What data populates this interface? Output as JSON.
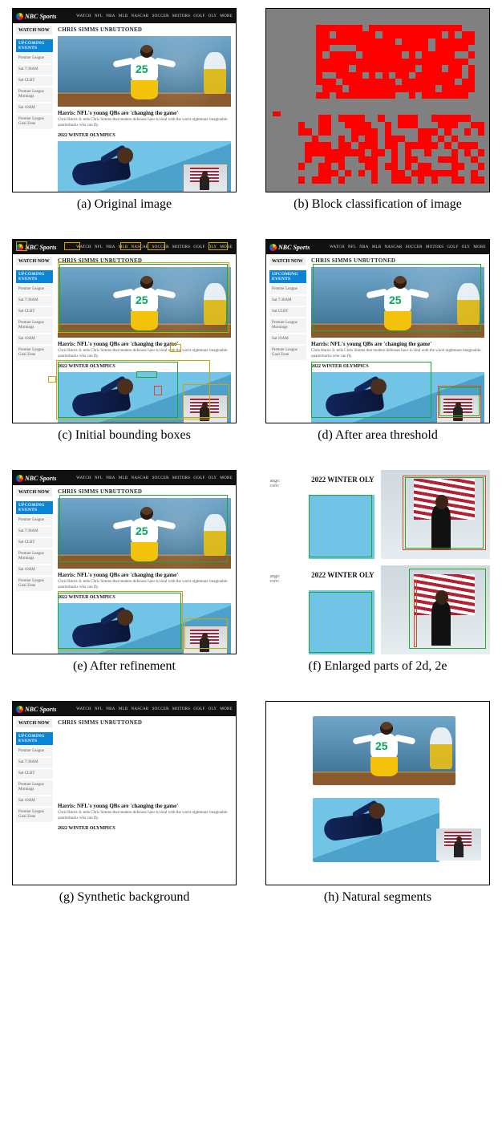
{
  "captions": {
    "a": "(a) Original image",
    "b": "(b) Block classification of image",
    "c": "(c) Initial bounding boxes",
    "d": "(d) After area threshold",
    "e": "(e) After refinement",
    "f": "(f) Enlarged parts of 2d, 2e",
    "g": "(g) Synthetic background",
    "h": "(h) Natural segments"
  },
  "site": {
    "brand": "NBC Sports",
    "nav": [
      "WATCH",
      "NFL",
      "NBA",
      "MLB",
      "NASCAR",
      "SOCCER",
      "MOTORS",
      "GOLF",
      "OLY",
      "MORE"
    ],
    "watch_now": "WATCH NOW",
    "upcoming": "UPCOMING EVENTS",
    "sidebar_items": [
      "Premier League",
      "Sat 7:30AM",
      "Sat CLBT",
      "Premier League Mornings",
      "Sat 10AM",
      "Premier League Goal Zone"
    ],
    "page_title": "CHRIS SIMMS UNBUTTONED",
    "hero_jersey_number": "25",
    "headline": "Harris: NFL's young QBs are 'changing the game'",
    "subhead": "Chris Harris Jr. tells Chris Simms that modern defenses have to deal with the worst nightmare imaginable: quarterbacks who can fly.",
    "section2_title": "2022 WINTER OLYMPICS"
  },
  "panel_f": {
    "label_top": "2022 WINTER OLY",
    "label_bottom": "2022 WINTER OLY",
    "side_text": "ange:\ncore:"
  }
}
